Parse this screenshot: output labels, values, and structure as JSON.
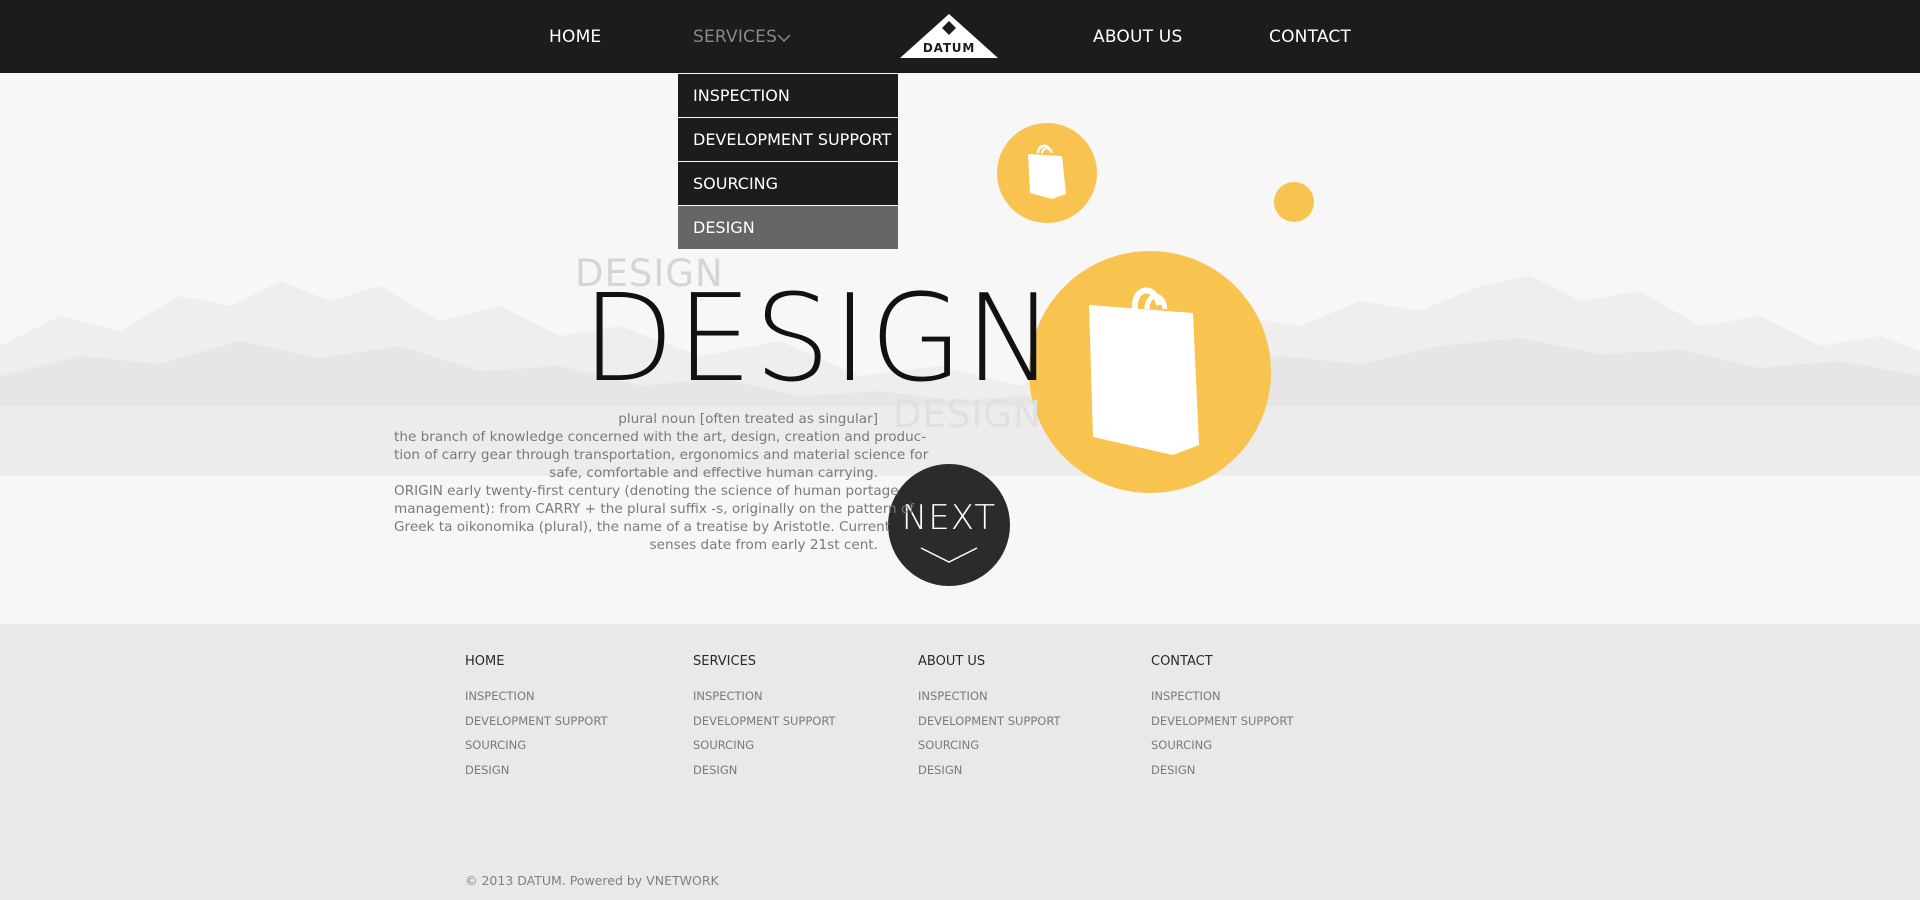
{
  "nav": {
    "home": "HOME",
    "services": "SERVICES",
    "about": "ABOUT US",
    "contact": "CONTACT",
    "logo_text": "DATUM"
  },
  "dropdown": {
    "items": [
      "INSPECTION",
      "DEVELOPMENT SUPPORT",
      "SOURCING",
      "DESIGN"
    ],
    "selected": "DESIGN"
  },
  "hero": {
    "ghost_top": "DESIGN",
    "title": "DESIGN",
    "ghost_bottom": "DESIGN",
    "definition": [
      "plural noun [often treated as singular]",
      "the branch of knowledge concerned with the art, design, creation and produc-",
      "tion of carry gear through transportation, ergonomics and material science for",
      "safe, comfortable and effective human carrying.",
      "ORIGIN early twenty-first century (denoting the science of human portage",
      "management): from CARRY + the plural suffix -s, originally on the pattern of",
      "Greek ta oikonomika (plural), the name of a treatise by Aristotle. Current",
      "senses date from early 21st cent."
    ],
    "next_label": "NEXT"
  },
  "footer": {
    "columns": [
      {
        "heading": "HOME",
        "links": [
          "INSPECTION",
          "DEVELOPMENT SUPPORT",
          "SOURCING",
          "DESIGN"
        ]
      },
      {
        "heading": "SERVICES",
        "links": [
          "INSPECTION",
          "DEVELOPMENT SUPPORT",
          "SOURCING",
          "DESIGN"
        ]
      },
      {
        "heading": "ABOUT US",
        "links": [
          "INSPECTION",
          "DEVELOPMENT SUPPORT",
          "SOURCING",
          "DESIGN"
        ]
      },
      {
        "heading": "CONTACT",
        "links": [
          "INSPECTION",
          "DEVELOPMENT SUPPORT",
          "SOURCING",
          "DESIGN"
        ]
      }
    ],
    "copyright": "© 2013 DATUM. Powered by VNETWORK"
  },
  "colors": {
    "topbar": "#1c1c1c",
    "accent_yellow": "#f8c34f",
    "dropdown_active": "#666666"
  },
  "icons": [
    "chevron-down-icon",
    "datum-logo",
    "shopping-bag-icon"
  ]
}
